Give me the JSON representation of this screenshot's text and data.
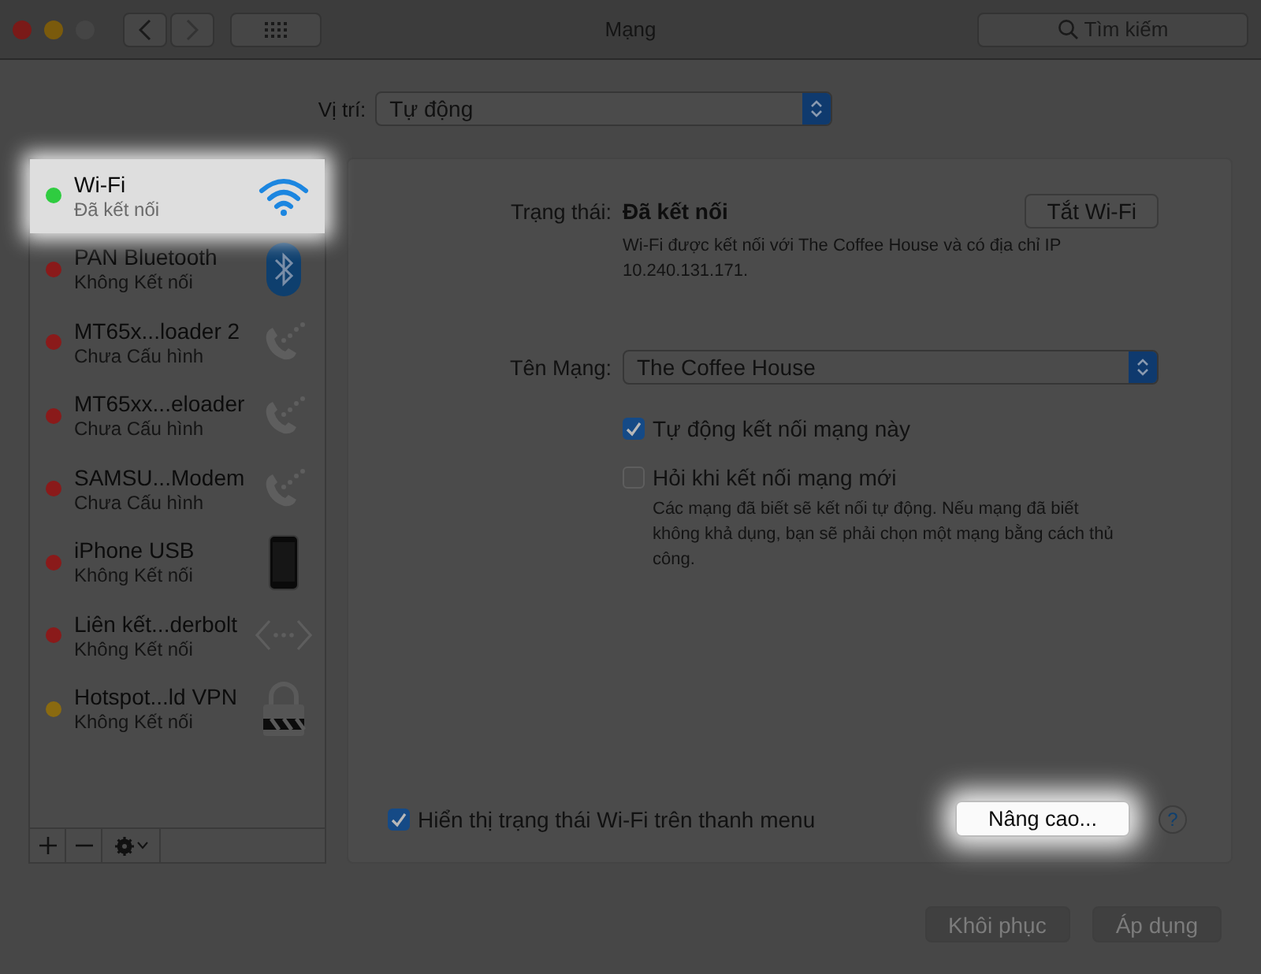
{
  "window": {
    "title": "Mạng",
    "search": {
      "placeholder": "Tìm kiếm"
    }
  },
  "location": {
    "label": "Vị trí:",
    "value": "Tự động"
  },
  "services": [
    {
      "name": "Wi-Fi",
      "status": "Đã kết nối",
      "color": "#2fcc40",
      "kind": "wifi",
      "selected": true
    },
    {
      "name": "PAN Bluetooth",
      "status": "Không Kết nối",
      "color": "#8a1a1a",
      "kind": "bluetooth",
      "selected": false
    },
    {
      "name": "MT65x...loader 2",
      "status": "Chưa Cấu hình",
      "color": "#8a1a1a",
      "kind": "phone",
      "selected": false
    },
    {
      "name": "MT65xx...eloader",
      "status": "Chưa Cấu hình",
      "color": "#8a1a1a",
      "kind": "phone",
      "selected": false
    },
    {
      "name": "SAMSU...Modem",
      "status": "Chưa Cấu hình",
      "color": "#8a1a1a",
      "kind": "phone",
      "selected": false
    },
    {
      "name": "iPhone USB",
      "status": "Không Kết nối",
      "color": "#8a1a1a",
      "kind": "iphone",
      "selected": false
    },
    {
      "name": "Liên kết...derbolt",
      "status": "Không Kết nối",
      "color": "#8a1a1a",
      "kind": "thunderbolt",
      "selected": false
    },
    {
      "name": "Hotspot...ld VPN",
      "status": "Không Kết nối",
      "color": "#8a6a10",
      "kind": "vpn",
      "selected": false
    }
  ],
  "detail": {
    "status_label": "Trạng thái:",
    "status_value": "Đã kết nối",
    "toggle_button": "Tắt Wi-Fi",
    "status_description": "Wi-Fi được kết nối với The Coffee House và có địa chỉ IP 10.240.131.171.",
    "network_label": "Tên Mạng:",
    "network_value": "The Coffee House",
    "options": [
      {
        "label": "Tự động kết nối mạng này",
        "checked": true
      },
      {
        "label": "Hỏi khi kết nối mạng mới",
        "checked": false
      }
    ],
    "note": "Các mạng đã biết sẽ kết nối tự động. Nếu mạng đã biết không khả dụng, bạn sẽ phải chọn một mạng bằng cách thủ công.",
    "show_status": {
      "label": "Hiển thị trạng thái Wi-Fi trên thanh menu",
      "checked": true
    },
    "advanced_button": {
      "label": "Nâng cao...",
      "highlighted": true
    },
    "help": "?"
  },
  "buttons": [
    {
      "label": "Khôi phục",
      "disabled": true
    },
    {
      "label": "Áp dụng",
      "disabled": true
    }
  ]
}
